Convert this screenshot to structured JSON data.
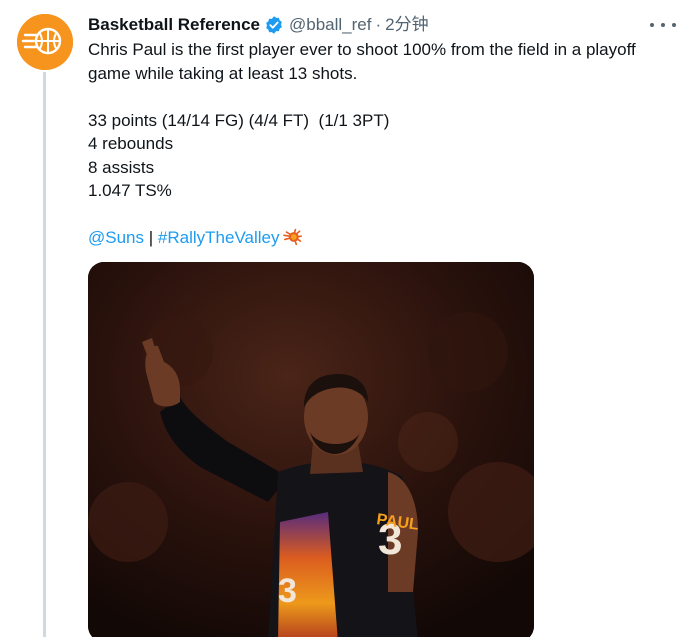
{
  "author": {
    "display_name": "Basketball Reference",
    "handle": "@bball_ref",
    "separator": "·",
    "time": "2分钟"
  },
  "tweet": {
    "line1": "Chris Paul is the first player ever to shoot 100% from the field in a playoff game while taking at least 13 shots.",
    "stats": [
      "33 points (14/14 FG) (4/4 FT)  (1/1 3PT)",
      "4 rebounds",
      "8 assists",
      "1.047 TS%"
    ],
    "mention": "@Suns",
    "divider": "|",
    "hashtag": "#RallyTheValley"
  },
  "media": {
    "jersey_name": "PAUL",
    "jersey_number": "3"
  },
  "icons": {
    "avatar": "basketball-reference-logo-icon",
    "verified": "verified-badge-icon",
    "more": "more-options-icon",
    "emoji": "suns-logo-emoji-icon"
  },
  "colors": {
    "link": "#1d9bf0",
    "secondary_text": "#536471",
    "avatar_bg": "#f7941d",
    "verified": "#1d9bf0"
  }
}
